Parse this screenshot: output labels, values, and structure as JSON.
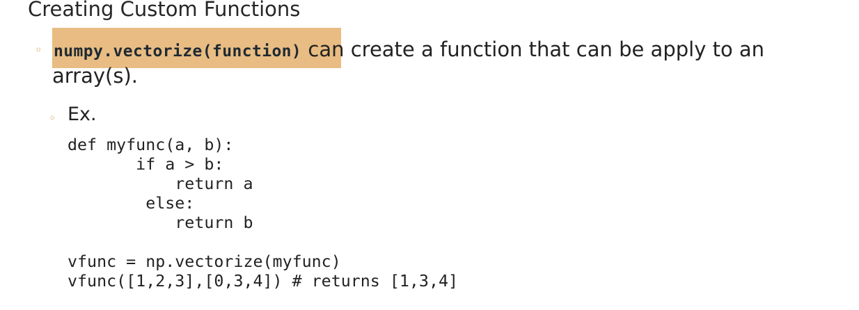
{
  "slide": {
    "title": "Creating Custom Functions",
    "bullet_symbol": "◦",
    "point": {
      "code": "numpy.vectorize(function)",
      "text_after_code": " can create a function that can be apply to an",
      "text_continuation": "array(s)."
    },
    "example": {
      "label": "Ex.",
      "code_lines": [
        "def myfunc(a, b):",
        "       if a > b:",
        "           return a",
        "        else:",
        "           return b",
        "",
        "vfunc = np.vectorize(myfunc)",
        "vfunc([1,2,3],[0,3,4]) # returns [1,3,4]"
      ]
    }
  },
  "colors": {
    "highlight": "#e8bc82",
    "bullet": "#d99a55",
    "text": "#222222"
  }
}
